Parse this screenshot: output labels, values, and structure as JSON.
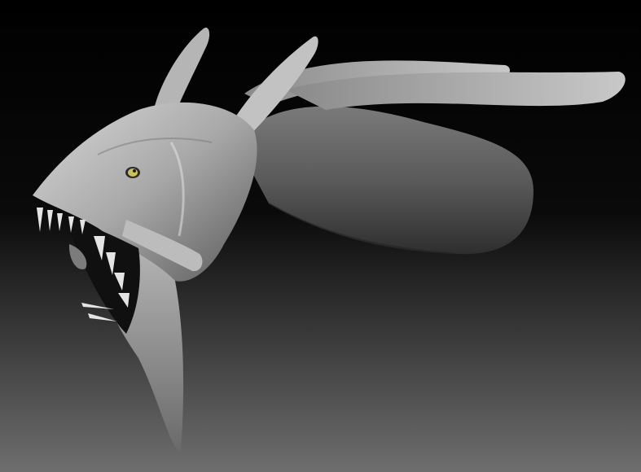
{
  "scene": {
    "subject": "sculpted-creature-head",
    "background": {
      "top": "#000000",
      "bottom": "#6e6e6e"
    },
    "material": {
      "light": "#e6e6e6",
      "mid": "#9a9a9a",
      "dark": "#3a3a3a",
      "eye": "#c9c25a"
    }
  }
}
